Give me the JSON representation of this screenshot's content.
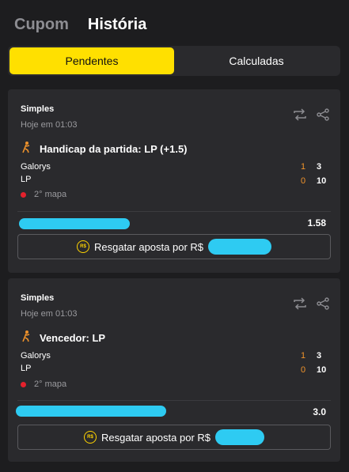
{
  "top_tabs": {
    "cupom": "Cupom",
    "historia": "História"
  },
  "segments": {
    "pendentes": "Pendentes",
    "calculadas": "Calculadas"
  },
  "colors": {
    "accent": "#ffe000",
    "score_orange": "#f0932b",
    "live_red": "#e4212c",
    "redaction": "#2ecbf2"
  },
  "cards": [
    {
      "type": "Simples",
      "date": "Hoje em 01:03",
      "market": "Handicap da partida: LP (+1.5)",
      "team1": {
        "name": "Galorys",
        "score_a": "1",
        "score_b": "3"
      },
      "team2": {
        "name": "LP",
        "score_a": "0",
        "score_b": "10"
      },
      "status": "2° mapa",
      "odds": "1.58",
      "cashout": "Resgatar aposta por R$",
      "coin": "R$"
    },
    {
      "type": "Simples",
      "date": "Hoje em 01:03",
      "market": "Vencedor: LP",
      "team1": {
        "name": "Galorys",
        "score_a": "1",
        "score_b": "3"
      },
      "team2": {
        "name": "LP",
        "score_a": "0",
        "score_b": "10"
      },
      "status": "2° mapa",
      "odds": "3.0",
      "cashout": "Resgatar aposta por R$",
      "coin": "R$"
    }
  ]
}
